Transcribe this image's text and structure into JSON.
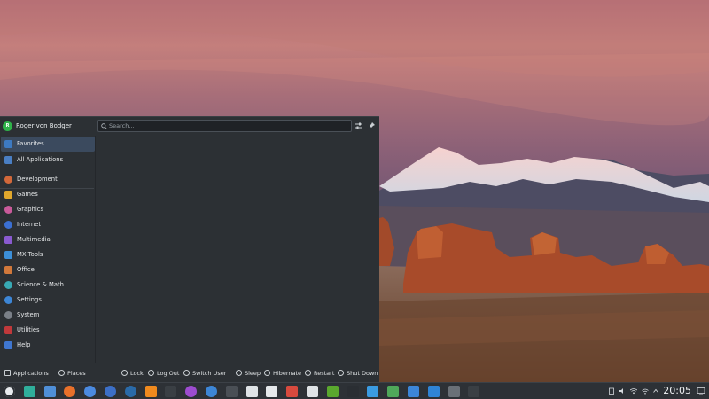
{
  "user": {
    "name": "Roger von Bodger",
    "initials": "R"
  },
  "search": {
    "placeholder": "Search..."
  },
  "sidebar": {
    "items": [
      {
        "label": "Favorites",
        "icon": "star-icon",
        "color": "#3d7ac2"
      },
      {
        "label": "All Applications",
        "icon": "grid-icon",
        "color": "#4a7fc4"
      },
      {
        "label": "Development",
        "icon": "code-icon",
        "color": "#d2683a"
      },
      {
        "label": "Games",
        "icon": "gamepad-icon",
        "color": "#e0a72c"
      },
      {
        "label": "Graphics",
        "icon": "palette-icon",
        "color": "#c95a9a"
      },
      {
        "label": "Internet",
        "icon": "globe-icon",
        "color": "#3b6fd1"
      },
      {
        "label": "Multimedia",
        "icon": "media-icon",
        "color": "#8a5ad0"
      },
      {
        "label": "MX Tools",
        "icon": "toolbox-icon",
        "color": "#3c8fd9"
      },
      {
        "label": "Office",
        "icon": "briefcase-icon",
        "color": "#d1783b"
      },
      {
        "label": "Science & Math",
        "icon": "atom-icon",
        "color": "#38a9b4"
      },
      {
        "label": "Settings",
        "icon": "gear-icon",
        "color": "#3d86d6"
      },
      {
        "label": "System",
        "icon": "system-icon",
        "color": "#7a8088"
      },
      {
        "label": "Utilities",
        "icon": "utilities-icon",
        "color": "#c0393b"
      },
      {
        "label": "Help",
        "icon": "help-icon",
        "color": "#3f76cf"
      }
    ]
  },
  "footer": {
    "tabs": {
      "applications": "Applications",
      "places": "Places"
    },
    "actions": {
      "lock": "Lock",
      "logout": "Log Out",
      "switch_user": "Switch User",
      "sleep": "Sleep",
      "hibernate": "Hibernate",
      "restart": "Restart",
      "shutdown": "Shut Down"
    }
  },
  "taskbar": {
    "clock": "20:05",
    "apps": [
      {
        "name": "mx-launcher-icon",
        "color": "#e9ecef"
      },
      {
        "name": "settings-app-icon",
        "color": "#2fae9b"
      },
      {
        "name": "file-manager-icon",
        "color": "#4f8fd8"
      },
      {
        "name": "firefox-icon",
        "color": "#e8702a"
      },
      {
        "name": "chromium-icon",
        "color": "#4b8ae0"
      },
      {
        "name": "thunderbird-icon",
        "color": "#3c6fc7"
      },
      {
        "name": "steam-icon",
        "color": "#2a6aa8"
      },
      {
        "name": "vlc-icon",
        "color": "#f08a1e"
      },
      {
        "name": "terminal-icon",
        "color": "#3a3f44"
      },
      {
        "name": "spectacle-icon",
        "color": "#9d4cd0"
      },
      {
        "name": "web-browser-icon",
        "color": "#3d86d6"
      },
      {
        "name": "conky-icon",
        "color": "#4a4f55"
      },
      {
        "name": "software-updater-icon",
        "color": "#dfe3e6"
      },
      {
        "name": "document-viewer-icon",
        "color": "#e5e8eb"
      },
      {
        "name": "pdf-tool-icon",
        "color": "#d84a3e"
      },
      {
        "name": "package-installer-icon",
        "color": "#dfe3e6"
      },
      {
        "name": "nvidia-icon",
        "color": "#5aa82e"
      },
      {
        "name": "system-monitor-icon",
        "color": "#2a2e33"
      },
      {
        "name": "mx-tweak-icon",
        "color": "#3a9be2"
      },
      {
        "name": "android-icon",
        "color": "#4fa85a"
      },
      {
        "name": "network-tool-icon",
        "color": "#3c86d8"
      },
      {
        "name": "disk-tool-icon",
        "color": "#2f84d6"
      },
      {
        "name": "system-info-icon",
        "color": "#6a7077"
      },
      {
        "name": "terminal-emulator-icon",
        "color": "#3a3f44"
      }
    ]
  },
  "colors": {
    "accent": "#3d9ae9",
    "panel": "#2c3034",
    "taskbar": "#2d3136"
  }
}
